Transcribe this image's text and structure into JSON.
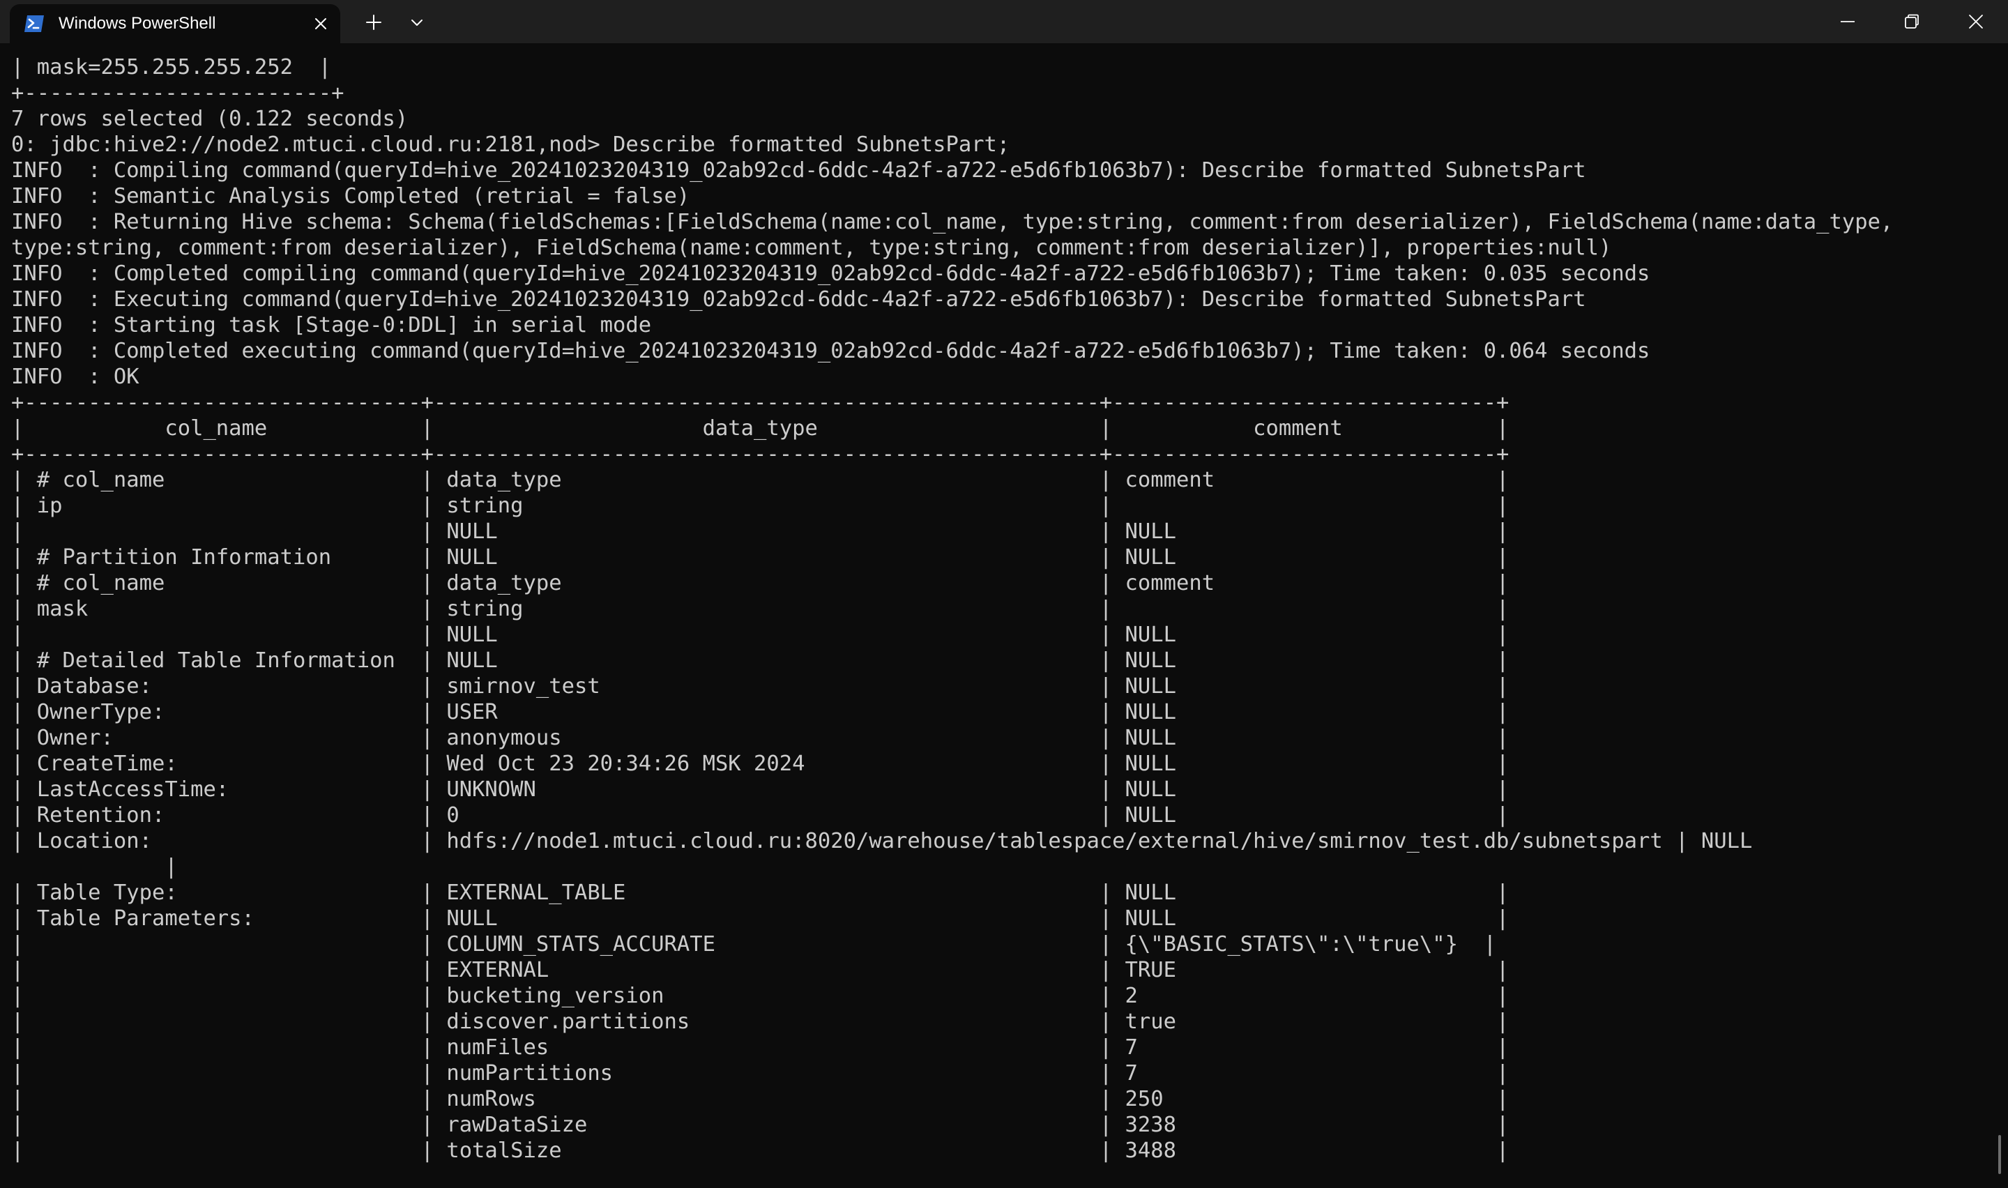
{
  "window": {
    "tab_title": "Windows PowerShell",
    "tab_icon": "powershell-icon",
    "controls": [
      "minimize-icon",
      "maximize-icon",
      "close-icon"
    ],
    "colors": {
      "titlebar": "#1f1f1f",
      "terminal_bg": "#0c0c0c",
      "text": "#cccccc",
      "icon_blue": "#2f6fd0"
    }
  },
  "terminal": {
    "text": "| mask=255.255.255.252  |\n+------------------------+\n7 rows selected (0.122 seconds)\n0: jdbc:hive2://node2.mtuci.cloud.ru:2181,nod> Describe formatted SubnetsPart;\nINFO  : Compiling command(queryId=hive_20241023204319_02ab92cd-6ddc-4a2f-a722-e5d6fb1063b7): Describe formatted SubnetsPart\nINFO  : Semantic Analysis Completed (retrial = false)\nINFO  : Returning Hive schema: Schema(fieldSchemas:[FieldSchema(name:col_name, type:string, comment:from deserializer), FieldSchema(name:data_type,\ntype:string, comment:from deserializer), FieldSchema(name:comment, type:string, comment:from deserializer)], properties:null)\nINFO  : Completed compiling command(queryId=hive_20241023204319_02ab92cd-6ddc-4a2f-a722-e5d6fb1063b7); Time taken: 0.035 seconds\nINFO  : Executing command(queryId=hive_20241023204319_02ab92cd-6ddc-4a2f-a722-e5d6fb1063b7): Describe formatted SubnetsPart\nINFO  : Starting task [Stage-0:DDL] in serial mode\nINFO  : Completed executing command(queryId=hive_20241023204319_02ab92cd-6ddc-4a2f-a722-e5d6fb1063b7); Time taken: 0.064 seconds\nINFO  : OK\n+-------------------------------+----------------------------------------------------+------------------------------+\n|           col_name            |                     data_type                      |           comment            |\n+-------------------------------+----------------------------------------------------+------------------------------+\n| # col_name                    | data_type                                          | comment                      |\n| ip                            | string                                             |                              |\n|                               | NULL                                               | NULL                         |\n| # Partition Information       | NULL                                               | NULL                         |\n| # col_name                    | data_type                                          | comment                      |\n| mask                          | string                                             |                              |\n|                               | NULL                                               | NULL                         |\n| # Detailed Table Information  | NULL                                               | NULL                         |\n| Database:                     | smirnov_test                                       | NULL                         |\n| OwnerType:                    | USER                                               | NULL                         |\n| Owner:                        | anonymous                                          | NULL                         |\n| CreateTime:                   | Wed Oct 23 20:34:26 MSK 2024                       | NULL                         |\n| LastAccessTime:               | UNKNOWN                                            | NULL                         |\n| Retention:                    | 0                                                  | NULL                         |\n| Location:                     | hdfs://node1.mtuci.cloud.ru:8020/warehouse/tablespace/external/hive/smirnov_test.db/subnetspart | NULL\n            |\n| Table Type:                   | EXTERNAL_TABLE                                     | NULL                         |\n| Table Parameters:             | NULL                                               | NULL                         |\n|                               | COLUMN_STATS_ACCURATE                              | {\\\"BASIC_STATS\\\":\\\"true\\\"}  |\n|                               | EXTERNAL                                           | TRUE                         |\n|                               | bucketing_version                                  | 2                            |\n|                               | discover.partitions                                | true                         |\n|                               | numFiles                                           | 7                            |\n|                               | numPartitions                                      | 7                            |\n|                               | numRows                                            | 250                          |\n|                               | rawDataSize                                        | 3238                         |\n|                               | totalSize                                          | 3488                         |"
  }
}
